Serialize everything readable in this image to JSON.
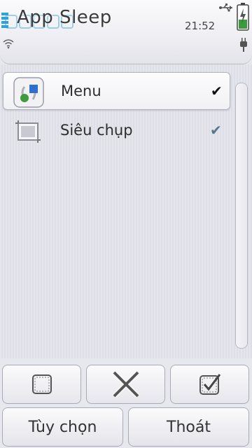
{
  "status_bar": {
    "app_title": "App Sleep",
    "time": "21:52",
    "icons": {
      "signal": "signal-bars-icon",
      "usb": "usb-icon",
      "battery": "battery-icon",
      "wifi": "wifi-icon",
      "charging": "plug-icon"
    }
  },
  "list": {
    "items": [
      {
        "label": "Menu",
        "icon": "menu-app-icon",
        "checked": true,
        "selected": true,
        "check_symbol": "✔"
      },
      {
        "label": "Siêu chụp",
        "icon": "screenshot-app-icon",
        "checked": true,
        "selected": false,
        "check_symbol": "✔"
      }
    ]
  },
  "toolbar": {
    "buttons": [
      {
        "name": "uncheck-all",
        "icon": "empty-square-icon"
      },
      {
        "name": "remove",
        "icon": "x-icon"
      },
      {
        "name": "check-all",
        "icon": "checked-square-icon"
      }
    ]
  },
  "softkeys": {
    "left_label": "Tùy chọn",
    "right_label": "Thoát"
  },
  "colors": {
    "accent": "#2fa3d6",
    "check_dark": "#111111",
    "check_muted": "#55788c",
    "battery_green": "#3a9b3a"
  }
}
